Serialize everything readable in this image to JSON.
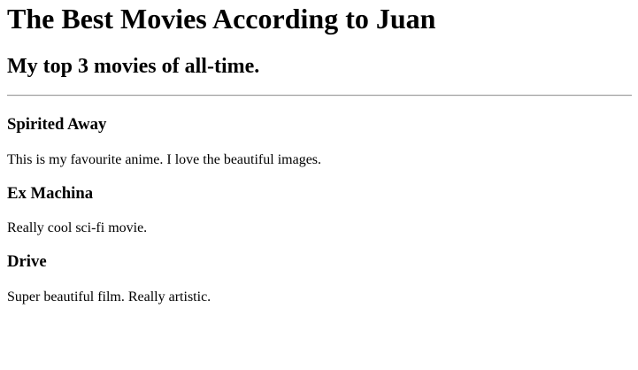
{
  "page": {
    "title": "The Best Movies According to Juan",
    "subtitle": "My top 3 movies of all-time."
  },
  "movies": [
    {
      "title": "Spirited Away",
      "description": "This is my favourite anime. I love the beautiful images."
    },
    {
      "title": "Ex Machina",
      "description": "Really cool sci-fi movie."
    },
    {
      "title": "Drive",
      "description": "Super beautiful film. Really artistic."
    }
  ]
}
